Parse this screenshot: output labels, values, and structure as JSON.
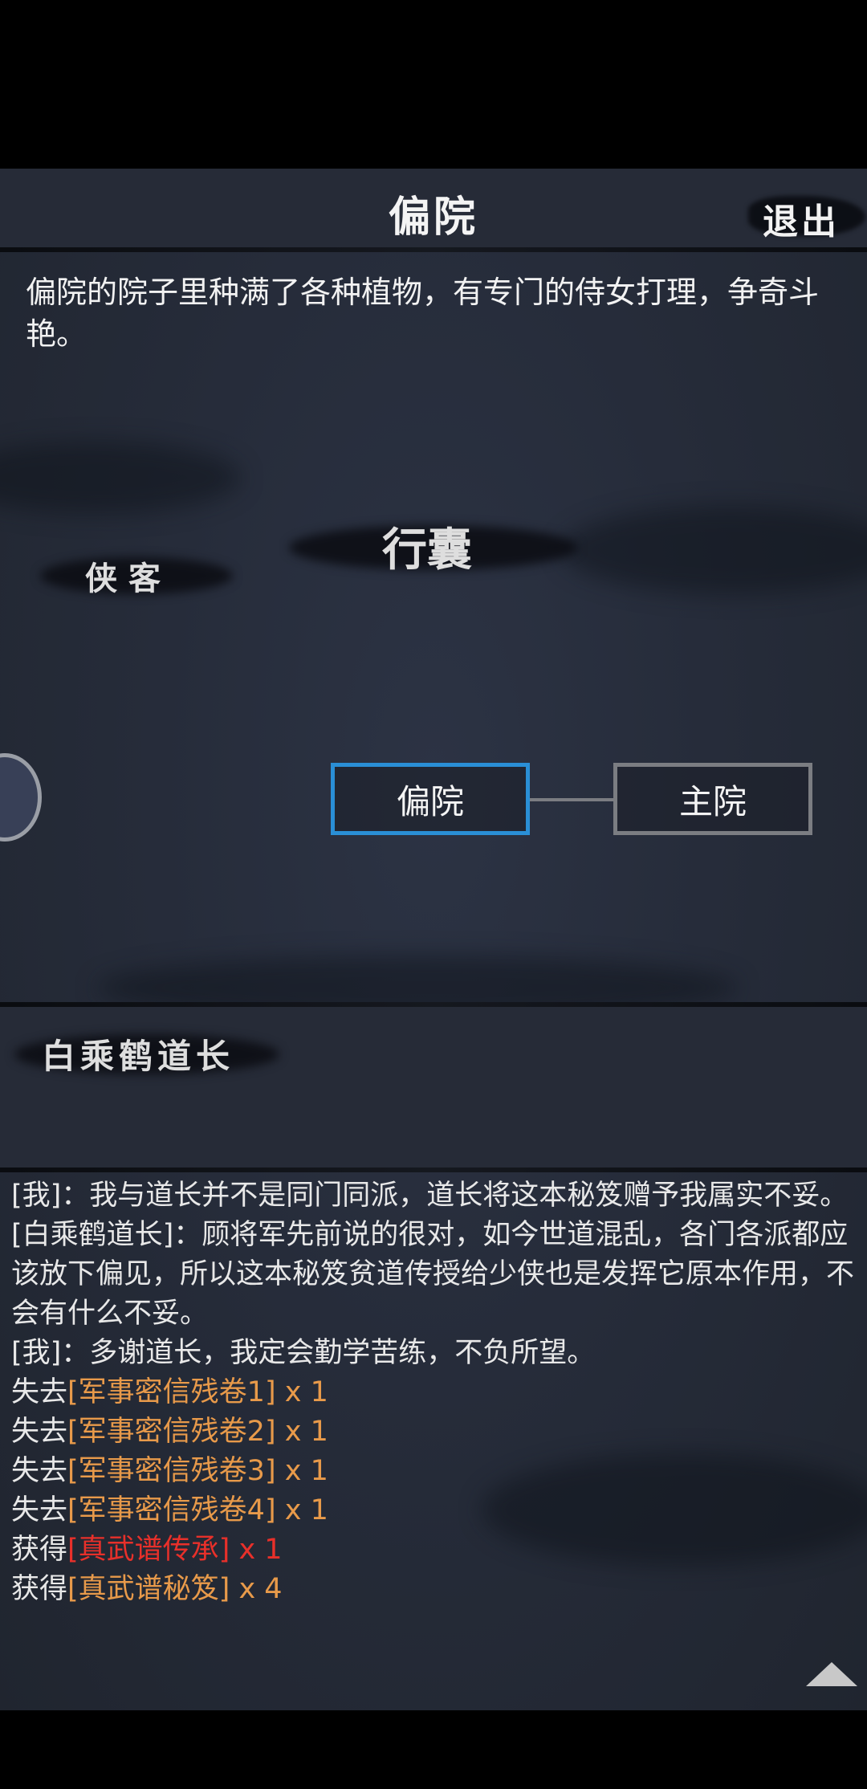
{
  "header": {
    "title": "偏院",
    "exit_label": "退出"
  },
  "location": {
    "description": "偏院的院子里种满了各种植物，有专门的侍女打理，争奇斗艳。"
  },
  "labels": {
    "inventory": "行囊",
    "hero": "侠客"
  },
  "map": {
    "current_node": "偏院",
    "other_node": "主院"
  },
  "npc": {
    "name": "白乘鹤道长"
  },
  "dialog": {
    "line1": "[我]：我与道长并不是同门同派，道长将这本秘笈赠予我属实不妥。",
    "line2": "[白乘鹤道长]：顾将军先前说的很对，如今世道混乱，各门各派都应该放下偏见，所以这本秘笈贫道传授给少侠也是发挥它原本作用，不会有什么不妥。",
    "line3": "[我]：多谢道长，我定会勤学苦练，不负所望。",
    "items": [
      {
        "action": "失去",
        "item": "[军事密信残卷1]",
        "qty": " x 1"
      },
      {
        "action": "失去",
        "item": "[军事密信残卷2]",
        "qty": " x 1"
      },
      {
        "action": "失去",
        "item": "[军事密信残卷3]",
        "qty": " x 1"
      },
      {
        "action": "失去",
        "item": "[军事密信残卷4]",
        "qty": " x 1"
      },
      {
        "action": "获得",
        "item": "[真武谱传承]",
        "qty": " x 1"
      },
      {
        "action": "获得",
        "item": "[真武谱秘笈]",
        "qty": " x 4"
      }
    ]
  },
  "colors": {
    "item_orange": "#e89a4a",
    "item_red": "#e8302a",
    "current_node_border": "#2a8fd6"
  }
}
